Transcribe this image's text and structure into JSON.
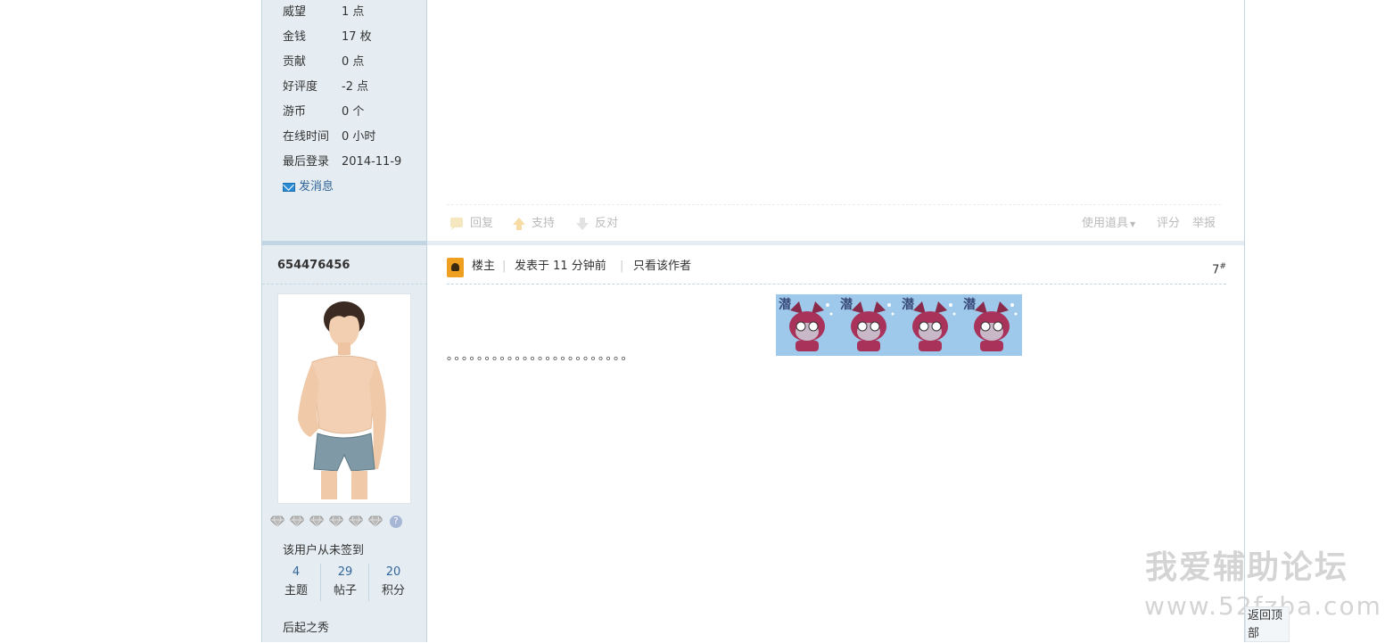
{
  "profile_top": {
    "stats": [
      {
        "key": "威望",
        "value": "1 点"
      },
      {
        "key": "金钱",
        "value": "17 枚"
      },
      {
        "key": "贡献",
        "value": "0 点"
      },
      {
        "key": "好评度",
        "value": "-2 点"
      },
      {
        "key": "游币",
        "value": "0 个"
      },
      {
        "key": "在线时间",
        "value": "0 小时"
      },
      {
        "key": "最后登录",
        "value": "2014-11-9"
      }
    ],
    "send_message": "发消息"
  },
  "prev_post_actions": {
    "reply": "回复",
    "support": "支持",
    "oppose": "反对",
    "use_tool": "使用道具",
    "rate": "评分",
    "report": "举报"
  },
  "author": {
    "name": "654476456",
    "gem_count": 6,
    "checkin_status": "该用户从未签到",
    "counts": [
      {
        "value": "4",
        "label": "主题"
      },
      {
        "value": "29",
        "label": "帖子"
      },
      {
        "value": "20",
        "label": "积分"
      }
    ],
    "rank": "后起之秀"
  },
  "post": {
    "badge": "楼主",
    "posted": "发表于 11 分钟前",
    "only_author": "只看该作者",
    "floor": "7",
    "floor_mark": "#",
    "content": "。。。。。。。。。。。。。。。。。。。。。。。。",
    "sticker_char": "潜",
    "sticker_count": 4
  },
  "watermark": {
    "title": "我爱辅助论坛",
    "url": "www.52fzba.com"
  },
  "back_to_top": "返回顶部",
  "colors": {
    "side_bg": "#e5edf2",
    "border": "#c2d5e3",
    "link": "#336699",
    "badge": "#f0a020"
  }
}
